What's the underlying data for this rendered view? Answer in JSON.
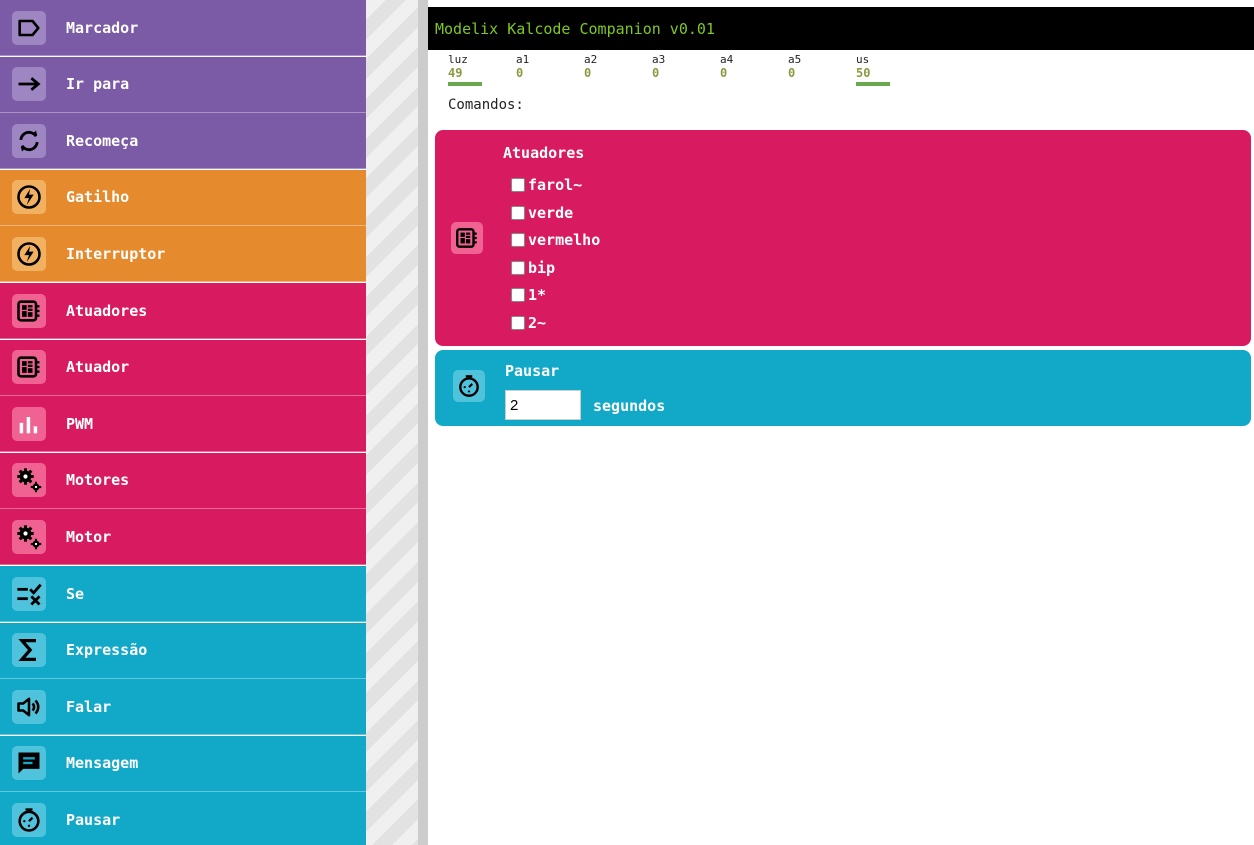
{
  "app": {
    "title": "Modelix Kalcode Companion v0.01"
  },
  "colors": {
    "purple": "#7b5aa6",
    "orange": "#e68a2e",
    "magenta": "#d81b60",
    "cyan": "#12a8c8",
    "title_text": "#7ec820",
    "sensor_bar": "#6aa84f"
  },
  "palette": [
    {
      "label": "Marcador",
      "icon": "tag-icon",
      "color": "#7b5aa6"
    },
    {
      "label": "Ir para",
      "icon": "arrow-right-icon",
      "color": "#7b5aa6"
    },
    {
      "label": "Recomeça",
      "icon": "restart-icon",
      "color": "#7b5aa6"
    },
    {
      "label": "Gatilho",
      "icon": "lightning-icon",
      "color": "#e68a2e"
    },
    {
      "label": "Interruptor",
      "icon": "lightning-icon",
      "color": "#e68a2e"
    },
    {
      "label": "Atuadores",
      "icon": "board-icon",
      "color": "#d81b60"
    },
    {
      "label": "Atuador",
      "icon": "board-icon",
      "color": "#d81b60"
    },
    {
      "label": "PWM",
      "icon": "bar-chart-icon",
      "color": "#d81b60"
    },
    {
      "label": "Motores",
      "icon": "gears-icon",
      "color": "#d81b60"
    },
    {
      "label": "Motor",
      "icon": "gears-icon",
      "color": "#d81b60"
    },
    {
      "label": "Se",
      "icon": "check-cross-icon",
      "color": "#12a8c8"
    },
    {
      "label": "Expressão",
      "icon": "sigma-icon",
      "color": "#12a8c8"
    },
    {
      "label": "Falar",
      "icon": "speaker-icon",
      "color": "#12a8c8"
    },
    {
      "label": "Mensagem",
      "icon": "message-icon",
      "color": "#12a8c8"
    },
    {
      "label": "Pausar",
      "icon": "timer-icon",
      "color": "#12a8c8"
    }
  ],
  "sensors": [
    {
      "label": "luz",
      "value": "49",
      "bar": true
    },
    {
      "label": "a1",
      "value": "0",
      "bar": false
    },
    {
      "label": "a2",
      "value": "0",
      "bar": false
    },
    {
      "label": "a3",
      "value": "0",
      "bar": false
    },
    {
      "label": "a4",
      "value": "0",
      "bar": false
    },
    {
      "label": "a5",
      "value": "0",
      "bar": false
    },
    {
      "label": "us",
      "value": "50",
      "bar": true
    }
  ],
  "commands_label": "Comandos:",
  "blocks": {
    "atuadores": {
      "title": "Atuadores",
      "icon": "board-icon",
      "items": [
        {
          "label": "farol~",
          "checked": false
        },
        {
          "label": "verde",
          "checked": false
        },
        {
          "label": "vermelho",
          "checked": false
        },
        {
          "label": "bip",
          "checked": false
        },
        {
          "label": "1*",
          "checked": false
        },
        {
          "label": "2~",
          "checked": false
        }
      ]
    },
    "pausar": {
      "title": "Pausar",
      "icon": "timer-icon",
      "value": "2",
      "unit": "segundos"
    }
  }
}
